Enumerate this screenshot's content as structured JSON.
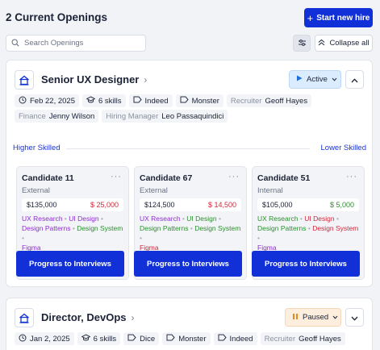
{
  "header": {
    "title": "2 Current Openings",
    "new_hire_label": "Start new hire",
    "search_placeholder": "Search Openings",
    "collapse_label": "Collapse all"
  },
  "openings": [
    {
      "title": "Senior UX Designer",
      "status": "Active",
      "date": "Feb 22, 2025",
      "skills": "6 skills",
      "boards": [
        "Indeed",
        "Monster"
      ],
      "recruiter_label": "Recruiter",
      "recruiter": "Geoff Hayes",
      "finance_label": "Finance",
      "finance": "Jenny Wilson",
      "hiring_manager_label": "Hiring Manager",
      "hiring_manager": "Leo Passaquindici",
      "skill_range": {
        "left": "Higher Skilled",
        "right": "Lower Skilled"
      },
      "candidates": [
        {
          "name": "Candidate 11",
          "source": "External",
          "salary": "$135,000",
          "delta": "$ 25,000",
          "delta_color": "#d0283d",
          "tags": [
            {
              "text": "UX Research",
              "color": "#8c2fd1"
            },
            {
              "text": "UI Design",
              "color": "#8c2fd1"
            },
            {
              "text": "Design Patterns",
              "color": "#8c2fd1"
            },
            {
              "text": "Design System",
              "color": "#2b8f2e"
            },
            {
              "text": "Figma",
              "color": "#8c2fd1"
            }
          ],
          "action": "Progress to Interviews"
        },
        {
          "name": "Candidate 67",
          "source": "External",
          "salary": "$124,500",
          "delta": "$ 14,500",
          "delta_color": "#d0283d",
          "tags": [
            {
              "text": "UX Research",
              "color": "#8c2fd1"
            },
            {
              "text": "UI Design",
              "color": "#2b8f2e"
            },
            {
              "text": "Design Patterns",
              "color": "#2b8f2e"
            },
            {
              "text": "Design System",
              "color": "#2b8f2e"
            },
            {
              "text": "Figma",
              "color": "#d0283d"
            }
          ],
          "action": "Progress to Interviews"
        },
        {
          "name": "Candidate 51",
          "source": "Internal",
          "salary": "$105,000",
          "delta": "$ 5,000",
          "delta_color": "#2b8f2e",
          "tags": [
            {
              "text": "UX Research",
              "color": "#2b8f2e"
            },
            {
              "text": "UI Design",
              "color": "#d0283d"
            },
            {
              "text": "Design Patterns",
              "color": "#2b8f2e"
            },
            {
              "text": "Design System",
              "color": "#d0283d"
            },
            {
              "text": "Figma",
              "color": "#8c2fd1"
            }
          ],
          "action": "Progress to Interviews"
        }
      ]
    },
    {
      "title": "Director, DevOps",
      "status": "Paused",
      "date": "Jan 2, 2025",
      "skills": "6 skills",
      "boards": [
        "Dice",
        "Monster",
        "Indeed"
      ],
      "recruiter_label": "Recruiter",
      "recruiter": "Geoff Hayes"
    }
  ],
  "icons": {
    "accent": "#1130d8",
    "role": "home-icon",
    "calendar": "calendar-icon",
    "skills": "graduation-cap-icon",
    "board": "tag-icon"
  }
}
